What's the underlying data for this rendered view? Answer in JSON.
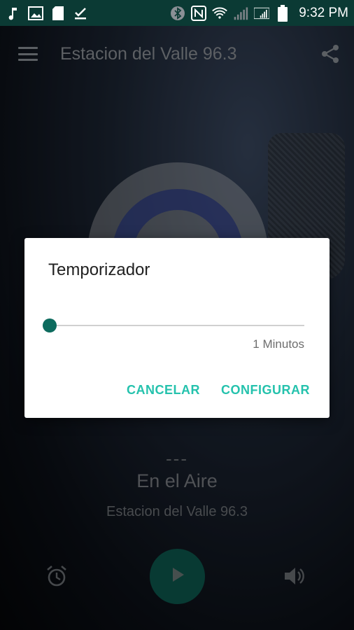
{
  "status_bar": {
    "time": "9:32 PM",
    "icons": [
      "music-note-icon",
      "image-icon",
      "sd-card-icon",
      "download-done-icon",
      "bluetooth-icon",
      "nfc-icon",
      "wifi-icon",
      "signal-icon",
      "signal-icon",
      "battery-icon"
    ]
  },
  "app_bar": {
    "title": "Estacion del Valle 96.3",
    "menu_icon": "hamburger-icon",
    "share_icon": "share-icon"
  },
  "player": {
    "track": "---",
    "status": "En el Aire",
    "station": "Estacion del Valle 96.3",
    "controls": [
      "alarm-icon",
      "play-icon",
      "volume-icon"
    ]
  },
  "dialog": {
    "title": "Temporizador",
    "slider_value_text": "1 Minutos",
    "slider_value": 1,
    "cancel_label": "CANCELAR",
    "confirm_label": "CONFIGURAR",
    "accent_color": "#25c2ad"
  }
}
